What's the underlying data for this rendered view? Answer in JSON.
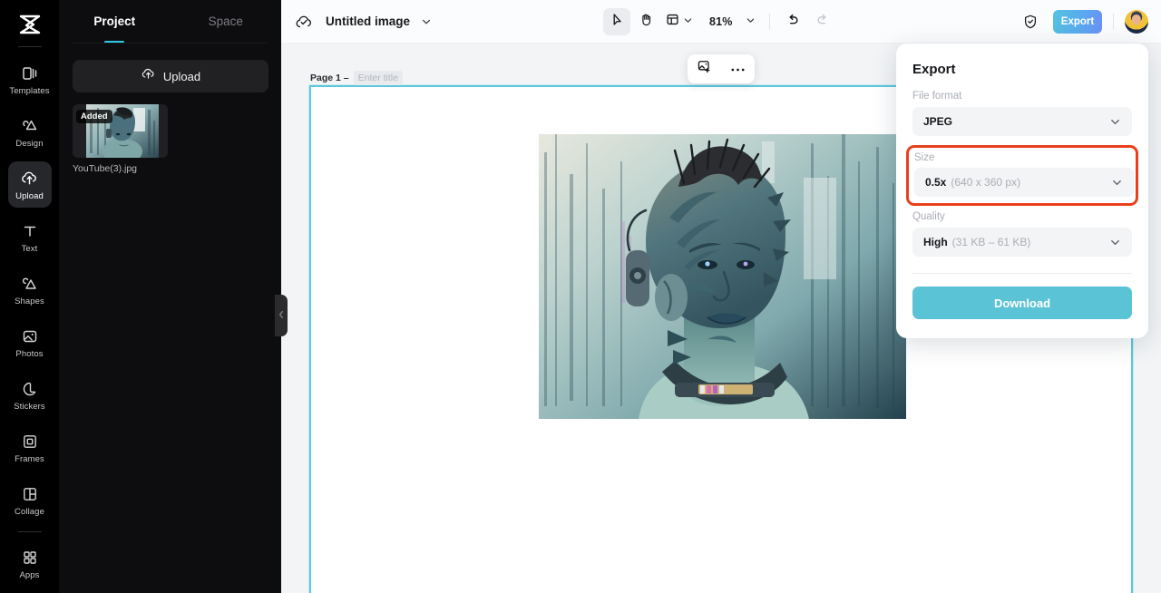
{
  "rail": {
    "logo_icon": "capcut-logo-icon",
    "items": [
      {
        "label": "Templates",
        "icon": "templates-icon",
        "active": false
      },
      {
        "label": "Design",
        "icon": "design-icon",
        "active": false
      },
      {
        "label": "Upload",
        "icon": "upload-cloud-icon",
        "active": true
      },
      {
        "label": "Text",
        "icon": "text-icon",
        "active": false
      },
      {
        "label": "Shapes",
        "icon": "shapes-icon",
        "active": false
      },
      {
        "label": "Photos",
        "icon": "photos-icon",
        "active": false
      },
      {
        "label": "Stickers",
        "icon": "stickers-icon",
        "active": false
      },
      {
        "label": "Frames",
        "icon": "frames-icon",
        "active": false
      },
      {
        "label": "Collage",
        "icon": "collage-icon",
        "active": false
      },
      {
        "label": "Apps",
        "icon": "apps-grid-icon",
        "active": false
      }
    ]
  },
  "panel": {
    "tabs": [
      {
        "label": "Project",
        "active": true
      },
      {
        "label": "Space",
        "active": false
      }
    ],
    "upload_label": "Upload",
    "upload_icon": "upload-cloud-icon",
    "assets": [
      {
        "name": "YouTube(3).jpg",
        "badge": "Added"
      }
    ],
    "collapse_icon": "chevron-left-icon"
  },
  "topbar": {
    "cloud_icon": "cloud-saved-icon",
    "doc_title": "Untitled image",
    "title_caret_icon": "chevron-down-icon",
    "tools": [
      {
        "name": "select-tool",
        "icon": "cursor-arrow-icon",
        "selected": true
      },
      {
        "name": "hand-tool",
        "icon": "hand-icon",
        "selected": false
      },
      {
        "name": "layout-tool",
        "icon": "layout-panel-icon",
        "selected": false
      }
    ],
    "layout_caret_icon": "chevron-down-icon",
    "zoom_level": "81%",
    "zoom_caret_icon": "chevron-down-icon",
    "undo_icon": "undo-arrow-icon",
    "redo_icon": "redo-arrow-icon",
    "shield_icon": "shield-check-icon",
    "export_label": "Export",
    "avatar_icon": "user-avatar"
  },
  "workspace": {
    "page_label": "Page 1 –",
    "title_placeholder": "Enter title",
    "float_tools": [
      {
        "name": "add-image-button",
        "icon": "add-image-icon"
      },
      {
        "name": "more-options-button",
        "icon": "ellipsis-icon"
      }
    ]
  },
  "export_panel": {
    "title": "Export",
    "file_format": {
      "label": "File format",
      "value": "JPEG",
      "detail": "",
      "caret_icon": "chevron-down-icon"
    },
    "size": {
      "label": "Size",
      "value": "0.5x",
      "detail": "(640 x 360 px)",
      "caret_icon": "chevron-down-icon",
      "highlighted": true
    },
    "quality": {
      "label": "Quality",
      "value": "High",
      "detail": "(31 KB – 61 KB)",
      "caret_icon": "chevron-down-icon"
    },
    "download_label": "Download"
  },
  "colors": {
    "accent_teal": "#5bc3d6",
    "highlight_red": "#e8401c",
    "canvas_border": "#5bc8de",
    "tab_underline": "#2ec7e6",
    "rail_bg": "#000000",
    "panel_bg": "#0d0d0f",
    "workspace_bg": "#f2f4f6"
  }
}
